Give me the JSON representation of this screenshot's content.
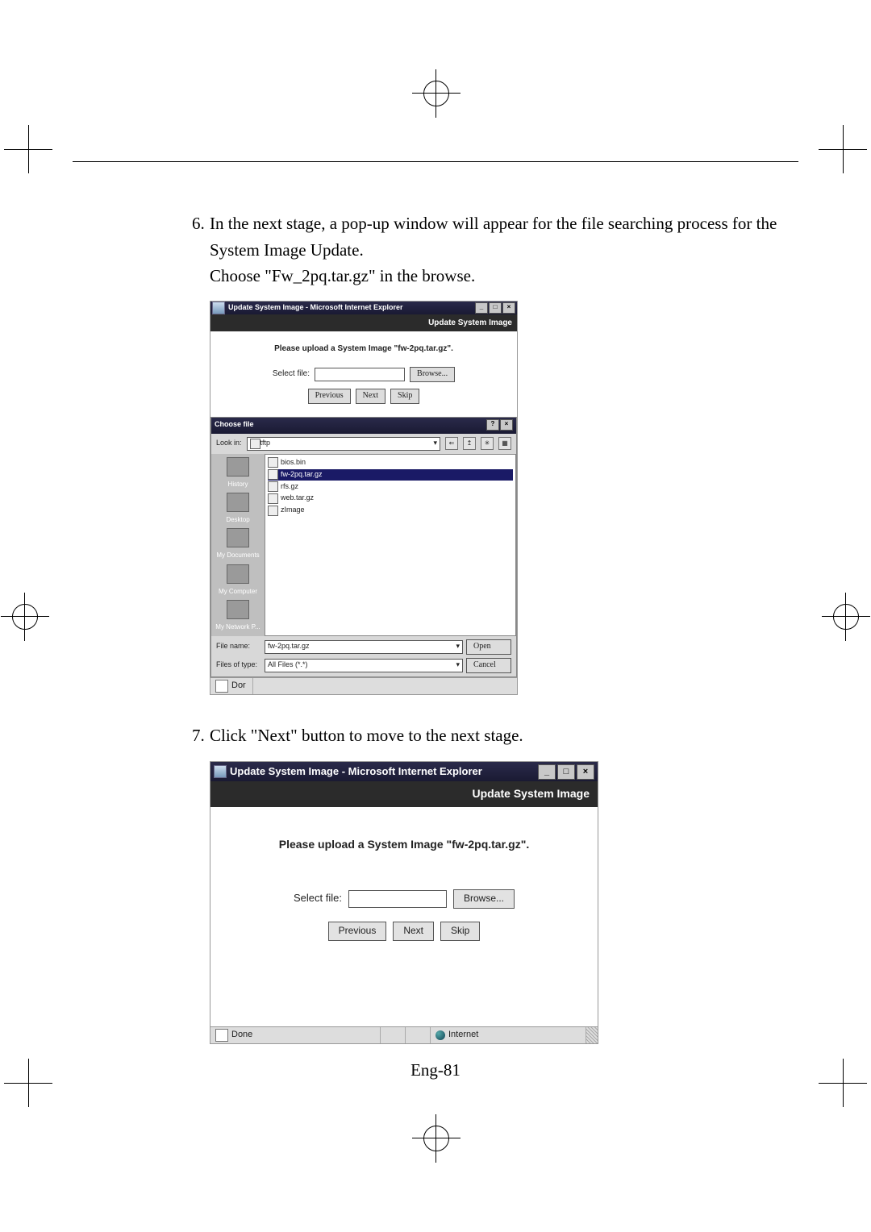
{
  "step6": {
    "num": "6.",
    "line1": "In the next stage, a pop-up window will appear for the file searching process for the",
    "line2": "System Image Update.",
    "line3": "Choose \"Fw_2pq.tar.gz\" in the browse."
  },
  "step7": {
    "num": "7.",
    "text": "Click \"Next\" button to move to the next stage."
  },
  "ie": {
    "title": "Update System Image - Microsoft Internet Explorer",
    "subheader": "Update System Image",
    "message": "Please upload a System Image \"fw-2pq.tar.gz\".",
    "select_file": "Select file:",
    "browse": "Browse...",
    "previous": "Previous",
    "next": "Next",
    "skip": "Skip",
    "status_done": "Done",
    "status_dor": "Dor",
    "status_internet": "Internet"
  },
  "dlg": {
    "title": "Choose file",
    "look_in_label": "Look in:",
    "look_in_value": "tftp",
    "places": [
      "History",
      "Desktop",
      "My Documents",
      "My Computer",
      "My Network P..."
    ],
    "files": [
      "bios.bin",
      "fw-2pq.tar.gz",
      "rfs.gz",
      "web.tar.gz",
      "zImage"
    ],
    "selected": "fw-2pq.tar.gz",
    "file_name_label": "File name:",
    "file_name_value": "fw-2pq.tar.gz",
    "files_of_type_label": "Files of type:",
    "files_of_type_value": "All Files (*.*)",
    "open": "Open",
    "cancel": "Cancel"
  },
  "page_number": "Eng-81"
}
